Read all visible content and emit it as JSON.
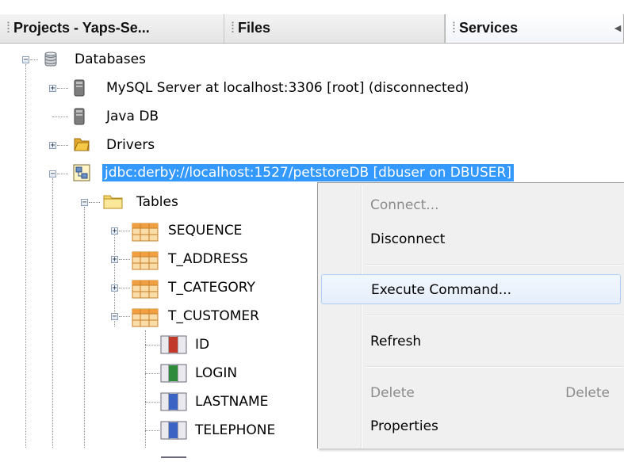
{
  "tabs": {
    "projects": "Projects - Yaps-Se...",
    "files": "Files",
    "services": "Services",
    "more": "◄"
  },
  "tree": {
    "databases": "Databases",
    "mysql": "MySQL Server at localhost:3306 [root] (disconnected)",
    "javadb": "Java DB",
    "drivers": "Drivers",
    "connection": "jdbc:derby://localhost:1527/petstoreDB [dbuser on DBUSER]",
    "tables": "Tables",
    "table_names": [
      "SEQUENCE",
      "T_ADDRESS",
      "T_CATEGORY",
      "T_CUSTOMER"
    ],
    "columns": [
      "ID",
      "LOGIN",
      "LASTNAME",
      "TELEPHONE"
    ]
  },
  "context_menu": {
    "connect": "Connect...",
    "disconnect": "Disconnect",
    "execute_command": "Execute Command...",
    "refresh": "Refresh",
    "delete": "Delete",
    "delete_shortcut": "Delete",
    "properties": "Properties"
  },
  "colors": {
    "selection": "#3399ff",
    "menu_background": "#f0f0f0",
    "menu_highlight_border": "#aecff7",
    "disabled_text": "#8b8b8b",
    "folder_yellow": "#f5d76e",
    "table_orange": "#f0a040"
  }
}
